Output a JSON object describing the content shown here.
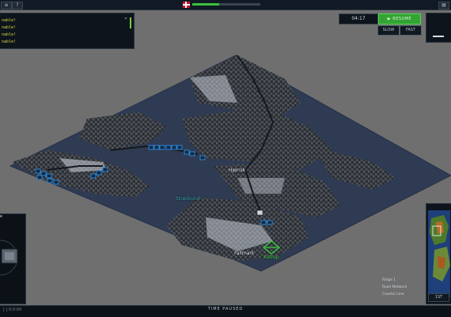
{
  "top_bar": {
    "left_button_icon": "menu-icon",
    "help_label": "?",
    "flag": "denmark-flag",
    "progress_fraction": 0.4,
    "right_button_icon": "layers-icon"
  },
  "notifications": [
    {
      "text": "nable!"
    },
    {
      "text": "nable!"
    },
    {
      "text": "nable!"
    },
    {
      "text": "nable!"
    }
  ],
  "time": {
    "clock": "04:17",
    "resume_label": "RESUME",
    "slow_label": "SLOW",
    "fast_label": "FAST"
  },
  "map_labels": {
    "city_a": "Fallmark",
    "city_b": "Hjørrsk",
    "waterway": "Strødsund",
    "objective": "Astrup"
  },
  "bottom_left_label": "e",
  "legend": [
    "Ridge 1",
    "Road Network",
    "Coastal Line"
  ],
  "minimap_button": "1ST",
  "status": "TIME PAUSED",
  "bottom_left_text": "[ ] 0:0:00",
  "colors": {
    "friendly": "#2e86d6",
    "objective": "#3cd33c",
    "resume": "#33a433",
    "notification": "#e0d24a"
  }
}
